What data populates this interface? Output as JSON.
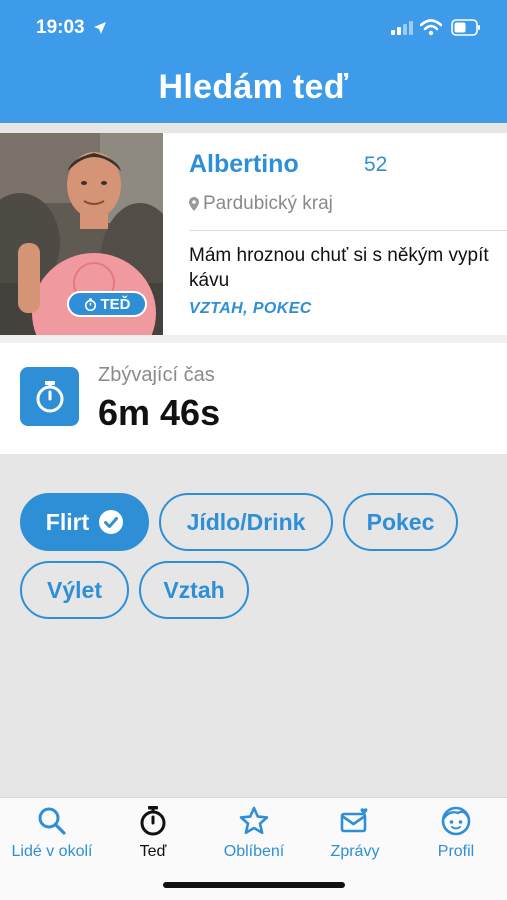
{
  "status_bar": {
    "time": "19:03"
  },
  "header": {
    "title": "Hledám teď"
  },
  "profile": {
    "name": "Albertino",
    "age": "52",
    "region": "Pardubický kraj",
    "bio": "Mám hroznou chuť si s někým vypít kávu",
    "interests": "VZTAH, POKEC",
    "badge": "TEĎ"
  },
  "timer": {
    "label": "Zbývající čas",
    "value": "6m 46s"
  },
  "chips": [
    {
      "label": "Flirt",
      "selected": true
    },
    {
      "label": "Jídlo/Drink",
      "selected": false
    },
    {
      "label": "Pokec",
      "selected": false
    },
    {
      "label": "Výlet",
      "selected": false
    },
    {
      "label": "Vztah",
      "selected": false
    }
  ],
  "tabs": [
    {
      "label": "Lidé v okolí",
      "icon": "search-icon",
      "active": false
    },
    {
      "label": "Teď",
      "icon": "stopwatch-icon",
      "active": true
    },
    {
      "label": "Oblíbení",
      "icon": "star-icon",
      "active": false
    },
    {
      "label": "Zprávy",
      "icon": "mail-heart-icon",
      "active": false
    },
    {
      "label": "Profil",
      "icon": "face-icon",
      "active": false
    }
  ],
  "colors": {
    "accent": "#2f8fd6",
    "header": "#3d9be9",
    "background": "#e6e6e6"
  }
}
